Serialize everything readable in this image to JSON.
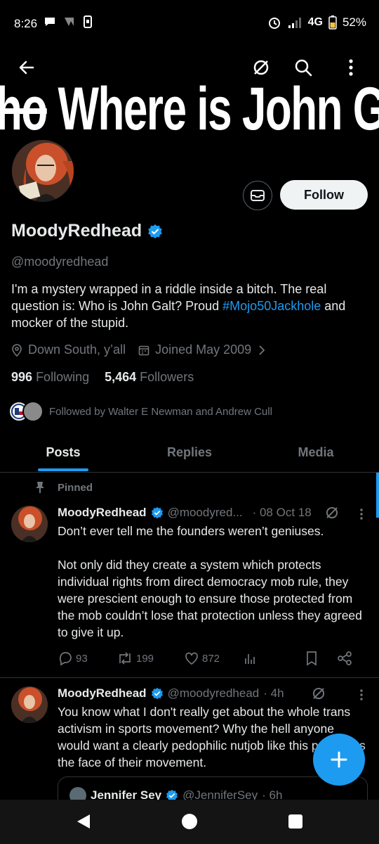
{
  "status_bar": {
    "time": "8:26",
    "network": "4G",
    "battery": "52%"
  },
  "banner": {
    "text_strike": "ho",
    "text": " Where is John Ga"
  },
  "profile": {
    "name": "MoodyRedhead",
    "handle": "@moodyredhead",
    "bio_part1": "I'm a mystery wrapped in a riddle inside a bitch. The real question is: Who is John Galt? Proud ",
    "bio_hashtag": "#Mojo50Jackhole",
    "bio_part2": " and mocker of the stupid.",
    "location": "Down South, y’all",
    "joined": "Joined May 2009",
    "following_count": "996",
    "following_label": "Following",
    "followers_count": "5,464",
    "followers_label": "Followers",
    "followed_by": "Followed by Walter E Newman and Andrew Cull",
    "follow_button": "Follow"
  },
  "tabs": [
    {
      "label": "Posts",
      "active": true
    },
    {
      "label": "Replies",
      "active": false
    },
    {
      "label": "Media",
      "active": false
    }
  ],
  "pinned_label": "Pinned",
  "tweets": [
    {
      "name": "MoodyRedhead",
      "handle": "@moodyred...",
      "time": "· 08 Oct 18",
      "text_line1": "Don’t ever tell me the founders weren’t geniuses.",
      "text_para2": "Not only did they create a system which protects individual rights from direct democracy mob rule, they were prescient enough to ensure those protected from the mob couldn’t lose that protection unless they agreed to give it up.",
      "replies": "93",
      "reposts": "199",
      "likes": "872"
    },
    {
      "name": "MoodyRedhead",
      "handle": "@moodyredhead",
      "time": "· 4h",
      "text": "You know what I don't really get about the whole trans activism in sports movement? Why the hell anyone would want a clearly pedophilic nutjob like this person as the face of their movement.",
      "quote_name": "Jennifer Sey",
      "quote_handle": "@JenniferSey",
      "quote_time": "· 6h"
    }
  ],
  "colors": {
    "accent": "#1d9bf0",
    "background": "#000000",
    "muted": "#71767b",
    "text": "#e7e9ea"
  }
}
